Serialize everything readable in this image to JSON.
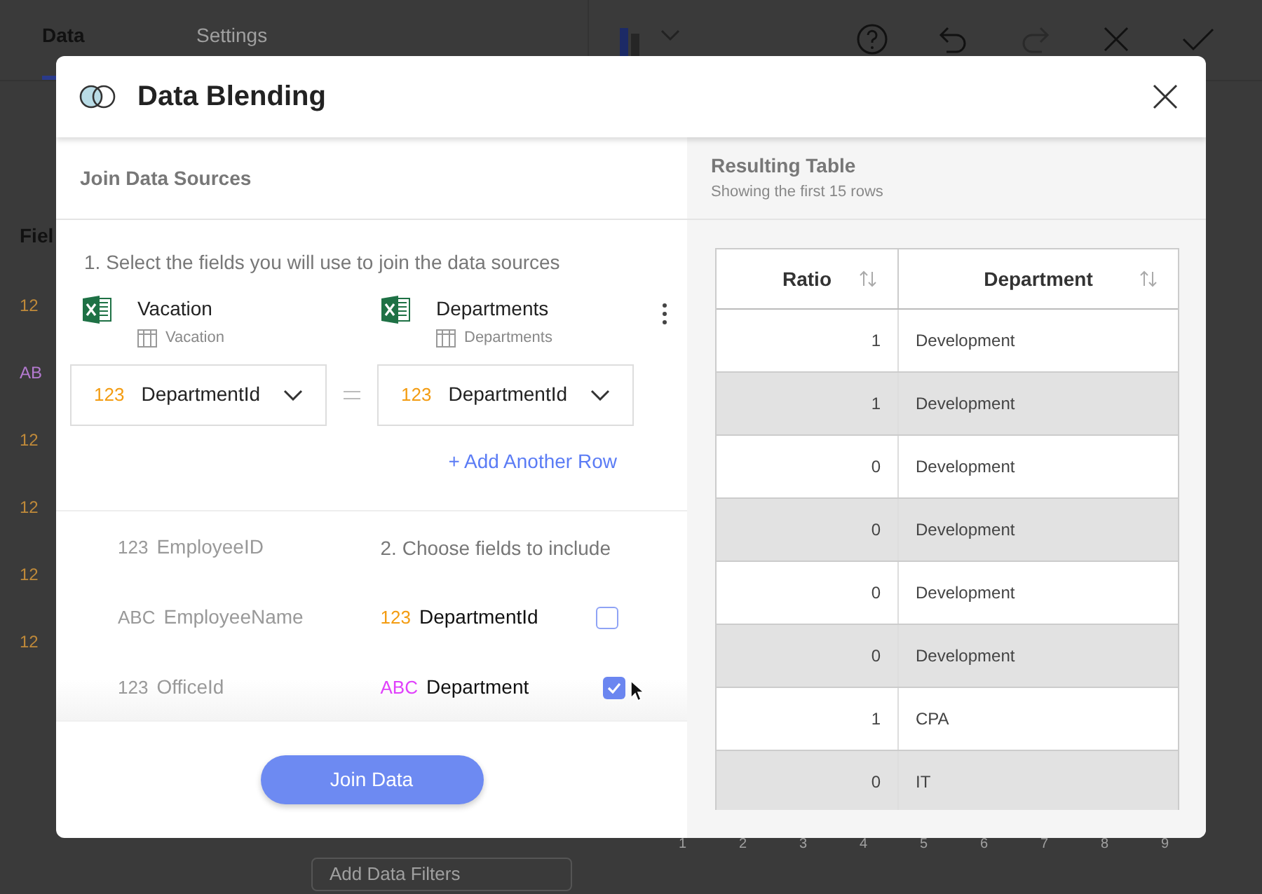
{
  "background": {
    "tabs": [
      {
        "label": "Data",
        "selected": true
      },
      {
        "label": "Settings",
        "selected": false
      }
    ],
    "sidebar_heading": "Fiel",
    "field_types": [
      {
        "label": "12",
        "kind": "number"
      },
      {
        "label": "AB",
        "kind": "text"
      },
      {
        "label": "12",
        "kind": "number"
      },
      {
        "label": "12",
        "kind": "number"
      },
      {
        "label": "12",
        "kind": "number"
      },
      {
        "label": "12",
        "kind": "number"
      }
    ],
    "axis_labels": [
      "1",
      "2",
      "3",
      "4",
      "5",
      "6",
      "7",
      "8",
      "9"
    ],
    "filter_button": "Add Data Filters"
  },
  "dialog": {
    "title": "Data Blending",
    "join_title": "Join Data Sources",
    "step_1": "1. Select the fields you will use to join the data sources",
    "sources": [
      {
        "name": "Vacation",
        "table": "Vacation",
        "join_field": {
          "type": "123",
          "kind": "number",
          "name": "DepartmentId"
        }
      },
      {
        "name": "Departments",
        "table": "Departments",
        "join_field": {
          "type": "123",
          "kind": "number",
          "name": "DepartmentId"
        }
      }
    ],
    "add_row": "+ Add Another Row",
    "left_fields": [
      {
        "type": "123",
        "name": "EmployeeID"
      },
      {
        "type": "ABC",
        "name": "EmployeeName"
      },
      {
        "type": "123",
        "name": "OfficeId"
      }
    ],
    "step_2": "2. Choose fields to include",
    "right_fields": [
      {
        "type": "123",
        "kind": "number",
        "name": "DepartmentId",
        "checked": false
      },
      {
        "type": "ABC",
        "kind": "text",
        "name": "Department",
        "checked": true
      }
    ],
    "join_button": "Join Data"
  },
  "result": {
    "title": "Resulting Table",
    "subtitle": "Showing the first 15 rows",
    "columns": [
      "Ratio",
      "Department"
    ],
    "rows": [
      [
        "1",
        "Development"
      ],
      [
        "1",
        "Development"
      ],
      [
        "0",
        "Development"
      ],
      [
        "0",
        "Development"
      ],
      [
        "0",
        "Development"
      ],
      [
        "0",
        "Development"
      ],
      [
        "1",
        "CPA"
      ],
      [
        "0",
        "IT"
      ]
    ]
  }
}
